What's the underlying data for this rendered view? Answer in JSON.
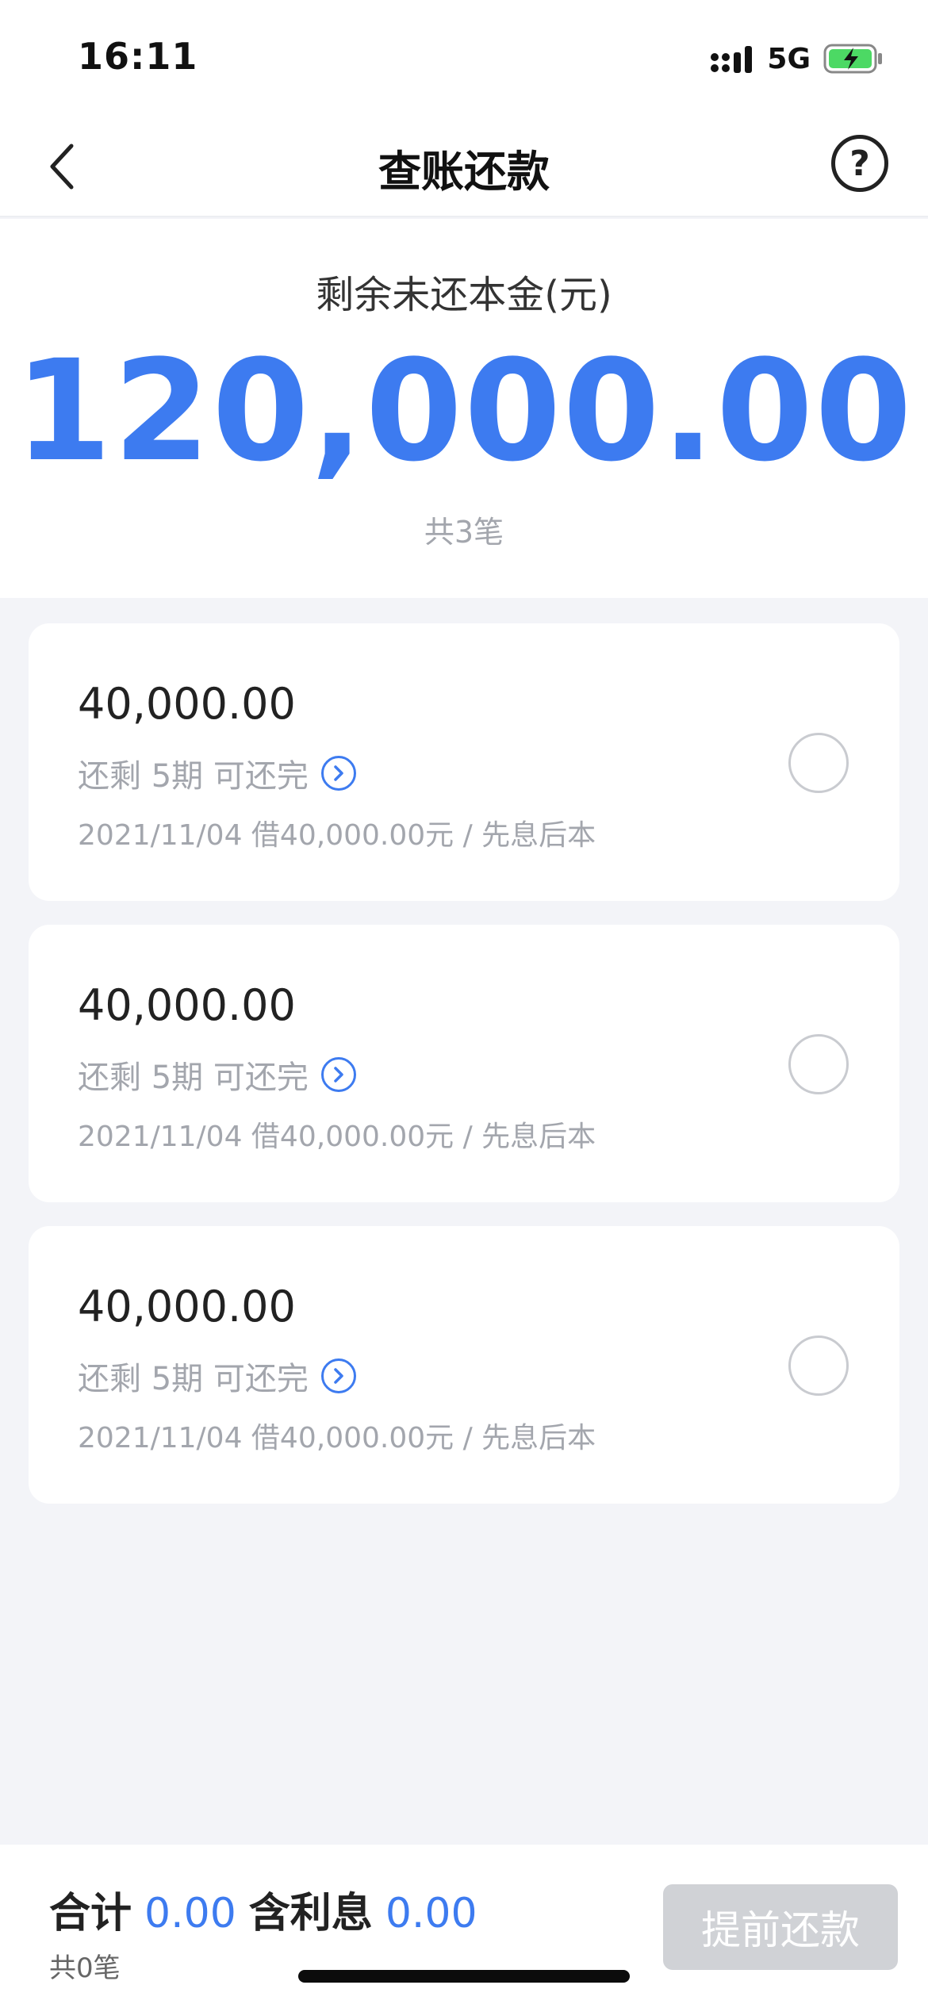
{
  "status_bar": {
    "time": "16:11",
    "network": "5G",
    "icons": [
      "signal-icon",
      "battery-charging-icon"
    ]
  },
  "nav": {
    "title": "查账还款",
    "back_icon": "chevron-left-icon",
    "help_label": "?"
  },
  "summary": {
    "label": "剩余未还本金(元)",
    "amount": "120,000.00",
    "count": "共3笔"
  },
  "loans": [
    {
      "amount": "40,000.00",
      "remaining": "还剩 5期 可还完",
      "detail": "2021/11/04 借40,000.00元 / 先息后本",
      "selected": false
    },
    {
      "amount": "40,000.00",
      "remaining": "还剩 5期 可还完",
      "detail": "2021/11/04 借40,000.00元 / 先息后本",
      "selected": false
    },
    {
      "amount": "40,000.00",
      "remaining": "还剩 5期 可还完",
      "detail": "2021/11/04 借40,000.00元 / 先息后本",
      "selected": false
    }
  ],
  "footer": {
    "total_label": "合计",
    "total_value": "0.00",
    "interest_label": "含利息",
    "interest_value": "0.00",
    "count": "共0笔",
    "button_label": "提前还款"
  },
  "colors": {
    "accent": "#3d7bf0",
    "background": "#f3f4f8",
    "disabled_button": "#d0d2d6"
  }
}
